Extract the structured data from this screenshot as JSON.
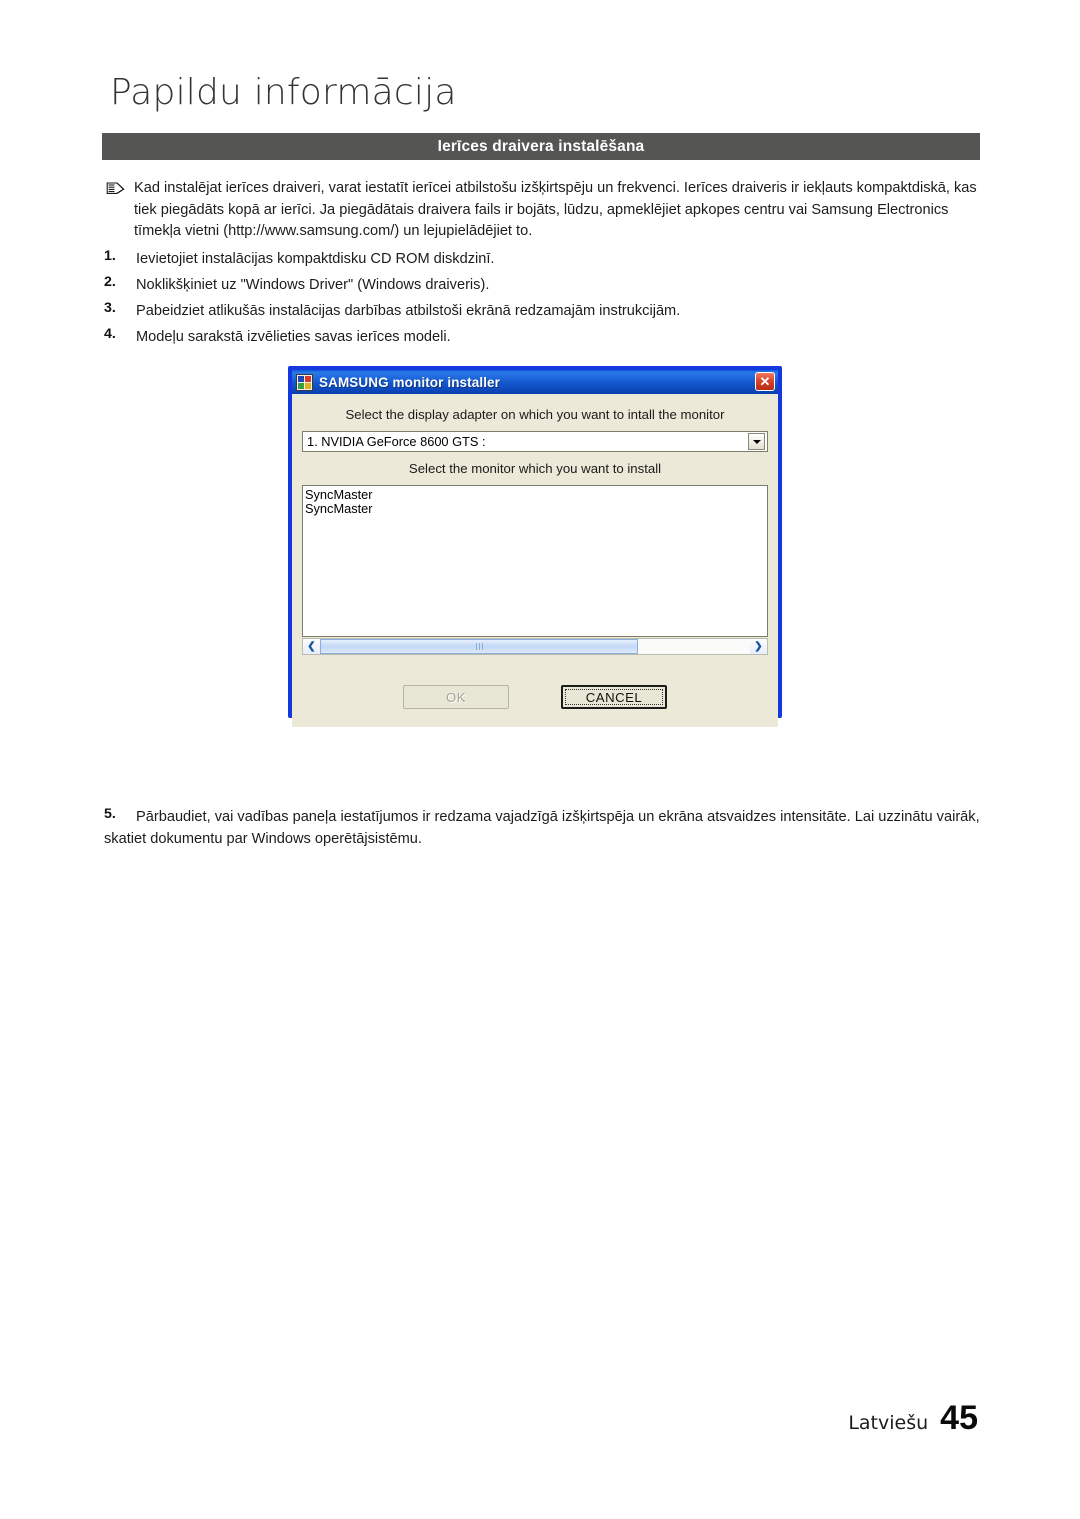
{
  "chapter": {
    "title": "Papildu informācija"
  },
  "section": {
    "banner_title": "Ierīces draivera instalēšana"
  },
  "note": {
    "icon": "pencil-note-icon",
    "text": "Kad instalējat ierīces draiveri, varat iestatīt ierīcei atbilstošu izšķirtspēju un frekvenci. Ierīces draiveris ir iekļauts kompaktdiskā, kas tiek piegādāts kopā ar ierīci. Ja piegādātais draivera fails ir bojāts, lūdzu, apmeklējiet apkopes centru vai Samsung Electronics tīmekļa vietni (http://www.samsung.com/) un lejupielādējiet to."
  },
  "steps": [
    {
      "num": "1.",
      "text": "Ievietojiet instalācijas kompaktdisku CD ROM diskdzinī."
    },
    {
      "num": "2.",
      "text": "Noklikšķiniet uz \"Windows Driver\" (Windows draiveris)."
    },
    {
      "num": "3.",
      "text": "Pabeidziet atlikušās instalācijas darbības atbilstoši ekrānā redzamajām instrukcijām."
    },
    {
      "num": "4.",
      "text": "Modeļu sarakstā izvēlieties savas ierīces modeli."
    }
  ],
  "steps_after": [
    {
      "num": "5.",
      "text": "Pārbaudiet, vai vadības paneļa iestatījumos ir redzama vajadzīgā izšķirtspēja un ekrāna atsvaidzes intensitāte. Lai uzzinātu vairāk, skatiet dokumentu par Windows operētājsistēmu."
    }
  ],
  "dialog": {
    "title": "SAMSUNG monitor installer",
    "title_icon": "samsung-installer-icon",
    "close_icon": "✕",
    "label_adapter": "Select the display adapter on which you want to intall the monitor",
    "adapter_value": "1. NVIDIA GeForce 8600 GTS :",
    "dropdown_icon": "chevron-down-icon",
    "label_monitor": "Select the monitor which you want to install",
    "monitor_list": [
      "SyncMaster",
      "SyncMaster"
    ],
    "scroll_left_icon": "❮",
    "scroll_right_icon": "❯",
    "ok_label": "OK",
    "cancel_label": "CANCEL"
  },
  "footer": {
    "language": "Latviešu",
    "page_number": "45"
  },
  "colors": {
    "banner_bg": "#555554",
    "dialog_border": "#1438dd",
    "dialog_face": "#ece9d8",
    "titlebar_blue": "#1256cd",
    "close_red": "#d9452b",
    "scroll_blue": "#c2d8f6"
  }
}
